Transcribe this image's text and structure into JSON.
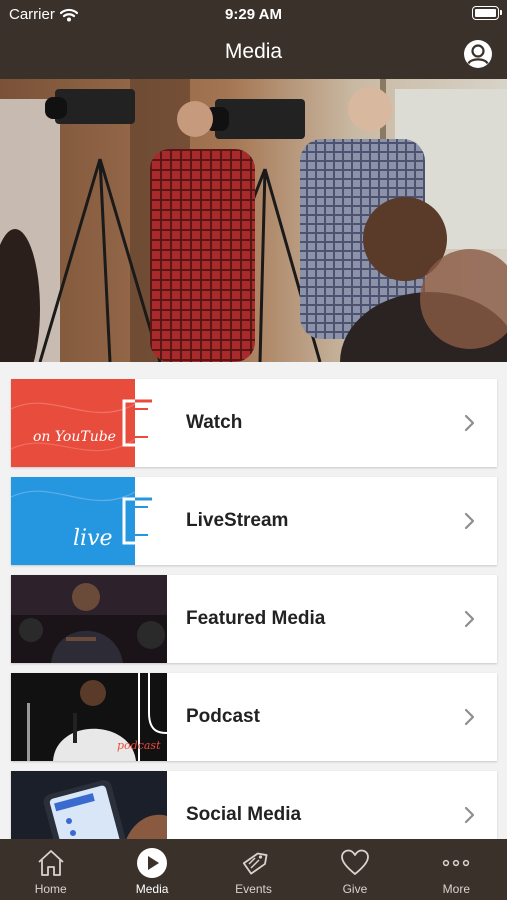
{
  "status": {
    "carrier": "Carrier",
    "time": "9:29 AM"
  },
  "nav": {
    "title": "Media"
  },
  "rows": [
    {
      "label": "Watch",
      "thumb": {
        "script": "on YouTube",
        "color": "#e84c3d"
      }
    },
    {
      "label": "LiveStream",
      "thumb": {
        "script": "live",
        "color": "#2596e0"
      }
    },
    {
      "label": "Featured Media"
    },
    {
      "label": "Podcast",
      "thumb": {
        "script": "podcast"
      }
    },
    {
      "label": "Social Media"
    }
  ],
  "tabs": [
    {
      "label": "Home",
      "icon": "home-icon"
    },
    {
      "label": "Media",
      "icon": "play-icon"
    },
    {
      "label": "Events",
      "icon": "tag-icon"
    },
    {
      "label": "Give",
      "icon": "heart-icon"
    },
    {
      "label": "More",
      "icon": "more-icon"
    }
  ],
  "colors": {
    "bar": "#3a312b",
    "background": "#f2f2f2"
  }
}
